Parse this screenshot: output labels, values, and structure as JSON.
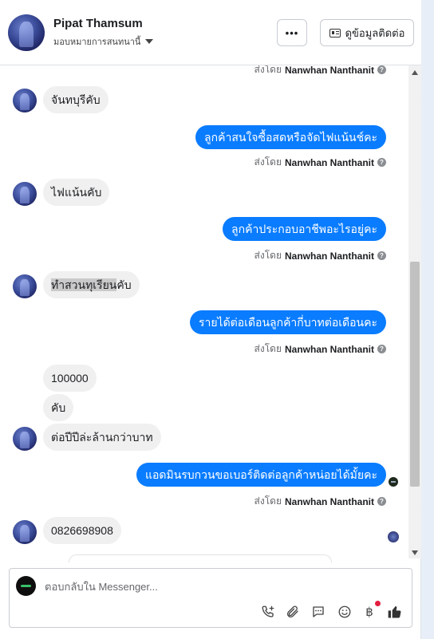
{
  "header": {
    "contact_name": "Pipat Thamsum",
    "assign_label": "มอบหมายการสนทนานี้",
    "more_label": "•••",
    "contact_info_label": "ดูข้อมูลติดต่อ"
  },
  "messages": {
    "sent_by_prefix": "ส่งโดย",
    "agent_name": "Nanwhan Nanthanit",
    "m1": "จันทบุรีคับ",
    "m2": "ลูกค้าสนใจซื้อสดหรือจัดไฟแน้นช์คะ",
    "m3": "ไฟแน้นคับ",
    "m4": "ลูกค้าประกอบอาชีพอะไรอยู่คะ",
    "m5_highlight": "ทำสวนทุเรียน",
    "m5_rest": "คับ",
    "m6": "รายได้ต่อเดือนลูกค้ากี่บาทต่อเดือนคะ",
    "m7": "100000",
    "m8": "คับ",
    "m9": "ต่อปีปีล่ะล้านกว่าบาท",
    "m10": "แอดมินรบกวนขอเบอร์ติดต่อลูกค้าหน่อยได้มั้ยคะ",
    "m11": "0826698908"
  },
  "composer": {
    "placeholder": "ตอบกลับใน Messenger..."
  },
  "colors": {
    "outgoing_bubble": "#0a7cff",
    "incoming_bubble": "#f0f0f0",
    "notification_dot": "#e41e3f"
  },
  "icons": [
    "ellipsis-icon",
    "id-card-icon",
    "caret-down-icon",
    "info-icon",
    "phone-plus-icon",
    "attachment-icon",
    "saved-reply-icon",
    "emoji-icon",
    "baht-icon",
    "thumbs-up-icon"
  ]
}
